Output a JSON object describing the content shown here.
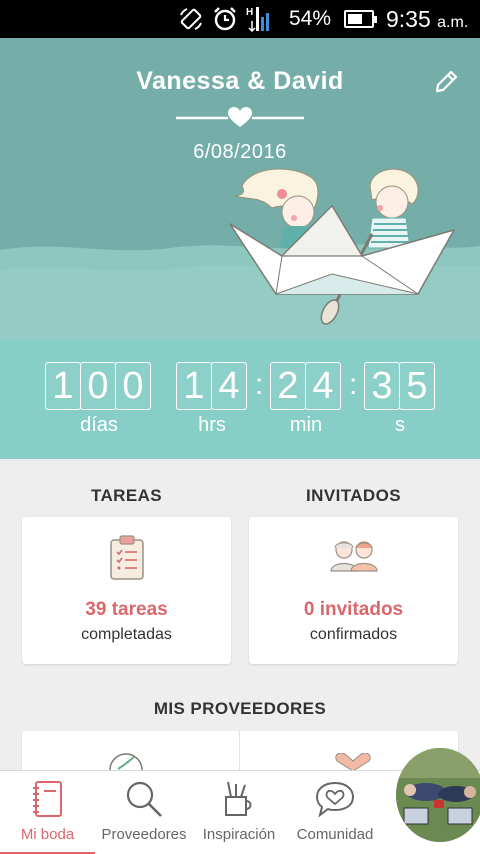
{
  "status_bar": {
    "battery": "54%",
    "battery_level": 0.54,
    "time": "9:35",
    "ampm": "a.m.",
    "icons": [
      "rotate-icon",
      "alarm-icon",
      "signal-icon"
    ]
  },
  "header": {
    "couple": "Vanessa & David",
    "date": "6/08/2016",
    "edit_icon": "pencil-icon"
  },
  "countdown": {
    "days": [
      "1",
      "0",
      "0"
    ],
    "hours": [
      "1",
      "4"
    ],
    "minutes": [
      "2",
      "4"
    ],
    "seconds": [
      "3",
      "5"
    ],
    "separator": ":",
    "labels": {
      "days": "días",
      "hours": "hrs",
      "minutes": "min",
      "seconds": "s"
    }
  },
  "tareas": {
    "title": "TAREAS",
    "count": "39 tareas",
    "sub": "completadas",
    "icon": "clipboard-icon"
  },
  "invitados": {
    "title": "INVITADOS",
    "count": "0 invitados",
    "sub": "confirmados",
    "icon": "guests-icon"
  },
  "proveedores": {
    "title": "MIS PROVEEDORES"
  },
  "nav": {
    "items": [
      {
        "label": "Mi boda",
        "icon": "notebook-icon",
        "active": true
      },
      {
        "label": "Proveedores",
        "icon": "search-icon",
        "active": false
      },
      {
        "label": "Inspiración",
        "icon": "inspiration-icon",
        "active": false
      },
      {
        "label": "Comunidad",
        "icon": "community-icon",
        "active": false
      }
    ]
  },
  "colors": {
    "header_bg": "#75aea8",
    "countdown_bg": "#87cec7",
    "accent": "#d9676b",
    "background": "#eeeeee"
  }
}
